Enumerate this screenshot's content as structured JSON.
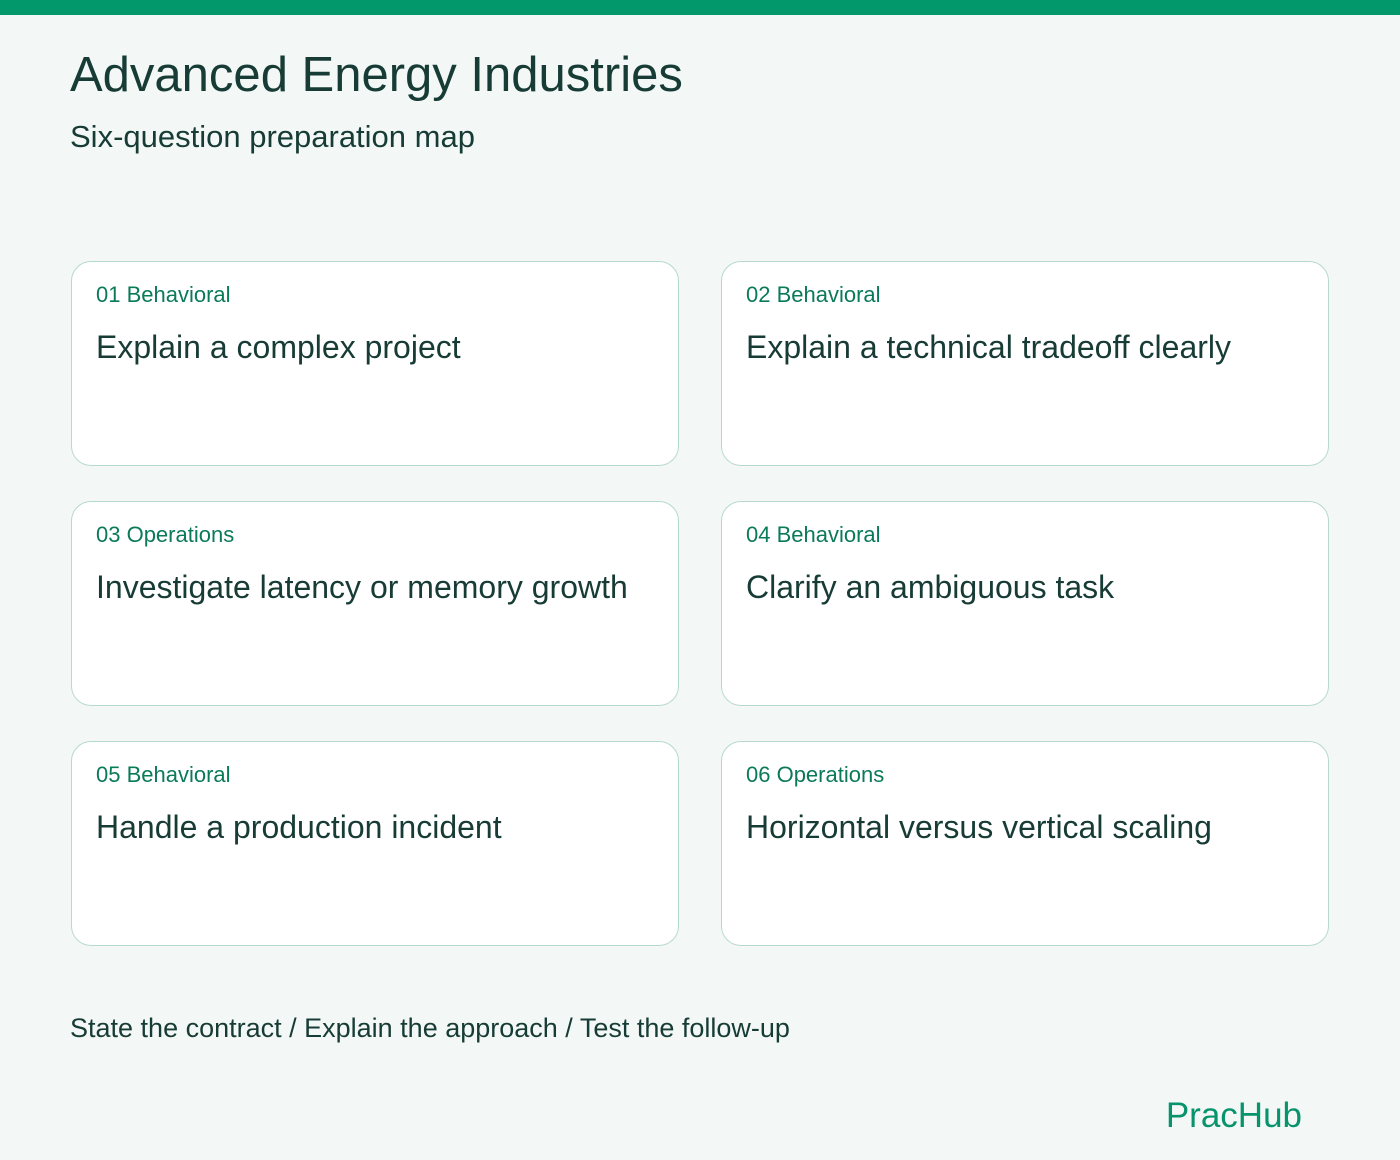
{
  "header": {
    "title": "Advanced Energy Industries",
    "subtitle": "Six-question preparation map"
  },
  "cards": [
    {
      "tag": "01 Behavioral",
      "title": "Explain a complex project"
    },
    {
      "tag": "02 Behavioral",
      "title": "Explain a technical tradeoff clearly"
    },
    {
      "tag": "03 Operations",
      "title": "Investigate latency or memory growth"
    },
    {
      "tag": "04 Behavioral",
      "title": "Clarify an ambiguous task"
    },
    {
      "tag": "05 Behavioral",
      "title": "Handle a production incident"
    },
    {
      "tag": "06 Operations",
      "title": "Horizontal versus vertical scaling"
    }
  ],
  "footer": {
    "steps": "State the contract / Explain the approach / Test the follow-up",
    "brand": "PracHub"
  },
  "colors": {
    "accent": "#03986c",
    "background": "#f3f8f6",
    "card_border": "#b7d9cd",
    "text": "#173b35",
    "tag": "#0b7a59"
  }
}
